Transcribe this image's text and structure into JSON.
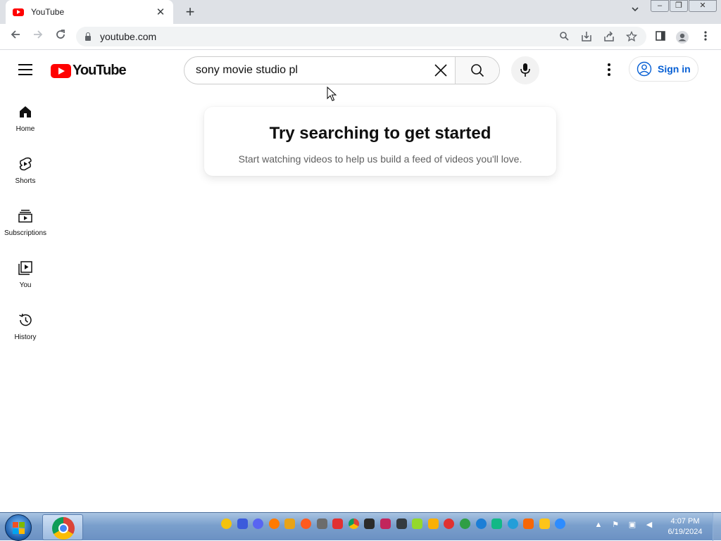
{
  "browser": {
    "tab_title": "YouTube",
    "tab_close": "✕",
    "new_tab": "+",
    "url": "youtube.com"
  },
  "youtube": {
    "logo_text": "YouTube",
    "search_value": "sony movie studio pl",
    "sign_in_label": "Sign in",
    "brand_color": "#ff0000",
    "link_color": "#065fd4"
  },
  "sidebar": {
    "items": [
      {
        "label": "Home",
        "icon": "home-icon"
      },
      {
        "label": "Shorts",
        "icon": "shorts-icon"
      },
      {
        "label": "Subscriptions",
        "icon": "subscriptions-icon"
      },
      {
        "label": "You",
        "icon": "you-icon"
      },
      {
        "label": "History",
        "icon": "history-icon"
      }
    ]
  },
  "main": {
    "heading": "Try searching to get started",
    "subtext": "Start watching videos to help us build a feed of videos you'll love."
  },
  "taskbar": {
    "time": "4:07 PM",
    "date": "6/19/2024"
  }
}
